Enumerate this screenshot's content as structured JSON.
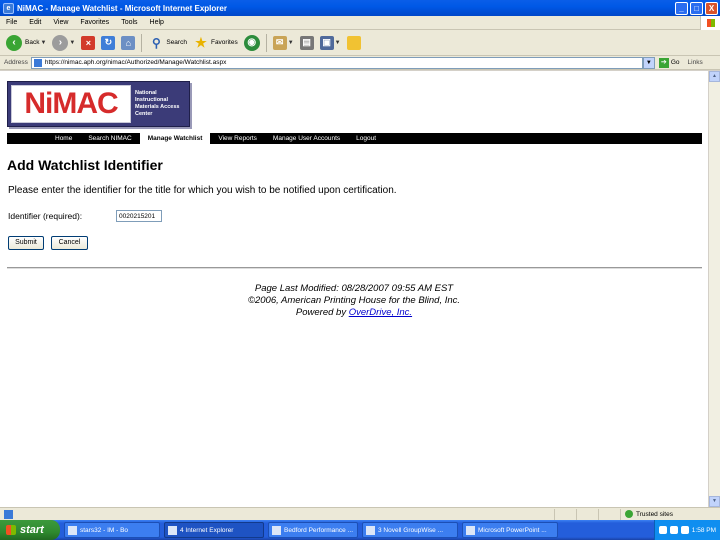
{
  "window": {
    "title": "NiMAC - Manage Watchlist - Microsoft Internet Explorer",
    "minimize": "_",
    "maximize": "□",
    "close": "X"
  },
  "menu": [
    "File",
    "Edit",
    "View",
    "Favorites",
    "Tools",
    "Help"
  ],
  "toolbar": {
    "back": "Back",
    "search": "Search",
    "favorites": "Favorites"
  },
  "address": {
    "label": "Address",
    "url": "https://nimac.aph.org/nimac/Authorized/Manage/Watchlist.aspx",
    "go": "Go",
    "links": "Links"
  },
  "logo": {
    "mark": "NiMAC",
    "subtitle": "National Instructional Materials Access Center"
  },
  "nav": [
    "Home",
    "Search NIMAC",
    "Manage Watchlist",
    "View Reports",
    "Manage User Accounts",
    "Logout"
  ],
  "nav_active": "Manage Watchlist",
  "page": {
    "title": "Add Watchlist Identifier",
    "instructions": "Please enter the identifier for the title for which you wish to be notified upon certification.",
    "identifier_label": "Identifier (required):",
    "identifier_value": "0020215201",
    "submit": "Submit",
    "cancel": "Cancel"
  },
  "footer": {
    "modified": "Page Last Modified: 08/28/2007 09:55 AM EST",
    "copyright": "©2006, American Printing House for the Blind, Inc.",
    "powered_by": "Powered by",
    "powered_link": "OverDrive, Inc."
  },
  "status": {
    "zone": "Trusted sites"
  },
  "taskbar": {
    "start": "start",
    "items": [
      "stars32 - IM - Bo",
      "4 Internet Explorer",
      "Bedford Performance ...",
      "3 Novell GroupWise ...",
      "Microsoft PowerPoint ..."
    ],
    "clock": "1:58 PM"
  }
}
